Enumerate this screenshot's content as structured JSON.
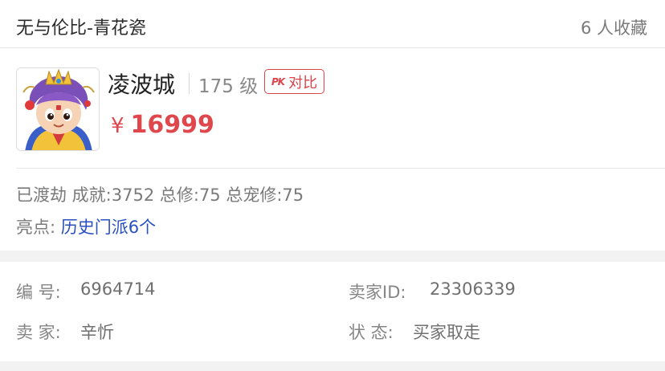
{
  "header": {
    "server_name": "无与伦比-青花瓷",
    "favorites": "6 人收藏"
  },
  "listing": {
    "character_name": "凌波城",
    "level": "175 级",
    "pk_icon_text": "PK",
    "compare_label": "对比",
    "currency": "¥",
    "price": "16999"
  },
  "stats": {
    "text": "已渡劫 成就:3752 总修:75 总宠修:75"
  },
  "highlight": {
    "label": "亮点:",
    "value": "历史门派6个"
  },
  "info": {
    "id_label": "编 号:",
    "id_value": "6964714",
    "seller_id_label": "卖家ID:",
    "seller_id_value": "23306339",
    "seller_label": "卖 家:",
    "seller_value": "辛忻",
    "status_label": "状 态:",
    "status_value": "买家取走"
  },
  "colors": {
    "price": "#e0474c",
    "highlight_link": "#2a4fc0",
    "pk_badge": "#d9454b"
  }
}
